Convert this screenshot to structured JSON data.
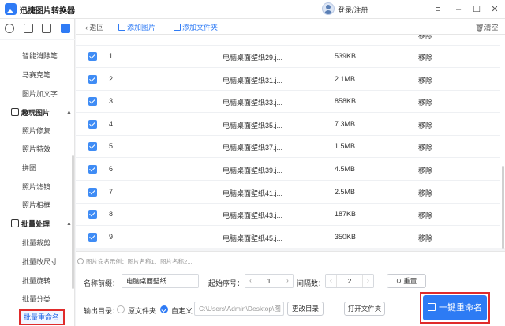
{
  "app": {
    "title": "迅捷图片转换器",
    "login": "登录/注册"
  },
  "window_controls": {
    "menu": "≡",
    "minimize": "–",
    "maximize": "☐",
    "close": "✕"
  },
  "sidebar": {
    "items_top": [
      "智能消除笔",
      "马赛克笔",
      "图片加文字"
    ],
    "group_play": {
      "label": "趣玩图片",
      "items": [
        "照片修复",
        "照片特效",
        "拼图",
        "照片滤镜",
        "照片相框"
      ]
    },
    "group_batch": {
      "label": "批量处理",
      "items": [
        "批量裁剪",
        "批量改尺寸",
        "批量旋转",
        "批量分类",
        "批量重命名"
      ]
    }
  },
  "toolbar": {
    "back": "返回",
    "add_image": "添加图片",
    "add_folder": "添加文件夹",
    "clear": "清空"
  },
  "table": {
    "top_partial_remove": "移除",
    "rows": [
      {
        "num": "1",
        "name": "电脑桌面壁纸29.j...",
        "size": "539KB",
        "action": "移除"
      },
      {
        "num": "2",
        "name": "电脑桌面壁纸31.j...",
        "size": "2.1MB",
        "action": "移除"
      },
      {
        "num": "3",
        "name": "电脑桌面壁纸33.j...",
        "size": "858KB",
        "action": "移除"
      },
      {
        "num": "4",
        "name": "电脑桌面壁纸35.j...",
        "size": "7.3MB",
        "action": "移除"
      },
      {
        "num": "5",
        "name": "电脑桌面壁纸37.j...",
        "size": "1.5MB",
        "action": "移除"
      },
      {
        "num": "6",
        "name": "电脑桌面壁纸39.j...",
        "size": "4.5MB",
        "action": "移除"
      },
      {
        "num": "7",
        "name": "电脑桌面壁纸41.j...",
        "size": "2.5MB",
        "action": "移除"
      },
      {
        "num": "8",
        "name": "电脑桌面壁纸43.j...",
        "size": "187KB",
        "action": "移除"
      },
      {
        "num": "9",
        "name": "电脑桌面壁纸45.j...",
        "size": "350KB",
        "action": "移除"
      }
    ]
  },
  "settings": {
    "hint": "图片命名示例：图片名称1、图片名称2...",
    "prefix_label": "名称前缀：",
    "prefix_value": "电脑桌面壁纸",
    "start_label": "起始序号：",
    "start_value": "1",
    "step_label": "间隔数：",
    "step_value": "2",
    "reset": "重置",
    "output_label": "输出目录：",
    "opt_original": "原文件夹",
    "opt_custom": "自定义",
    "path": "C:\\Users\\Admin\\Desktop\\图片转换器",
    "change_dir": "更改目录",
    "open_folder": "打开文件夹",
    "rename_all": "一键重命名"
  },
  "colors": {
    "accent": "#2d7bf4",
    "highlight_border": "#e02b2b"
  }
}
